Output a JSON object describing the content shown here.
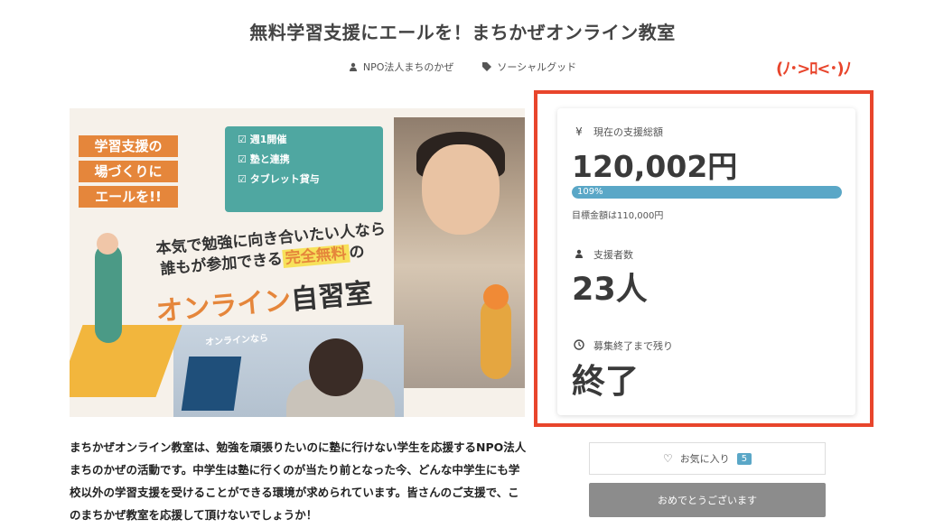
{
  "title": "無料学習支援にエールを！まちかぜオンライン教室",
  "meta": {
    "organizer": "NPO法人まちのかぜ",
    "category": "ソーシャルグッド"
  },
  "hero": {
    "tag1": "学習支援の",
    "tag2": "場づくりに",
    "tag3": "エールを!!",
    "feature1": "☑ 週1開催",
    "feature2": "☑ 塾と連携",
    "feature3": "☑ タブレット貸与",
    "catch1": "本気で勉強に向き合いたい人なら",
    "catch2a": "誰もが参加できる",
    "catch2b": "完全無料",
    "catch2c": "の",
    "big_a": "オンライン",
    "big_b": "自習室",
    "online_label": "オンラインなら"
  },
  "description": "まちかぜオンライン教室は、勉強を頑張りたいのに塾に行けない学生を応援するNPO法人まちのかぜの活動です。中学生は塾に行くのが当たり前となった今、どんな中学生にも学校以外の学習支援を受けることができる環境が求められています。皆さんのご支援で、このまちかぜ教室を応援して頂けないでしょうか！",
  "annotation": "(ﾉ･>ﾛ<･)ﾉ",
  "funding": {
    "total_label": "現在の支援総額",
    "total_value": "120,002円",
    "progress_text": "109%",
    "progress_fraction": 1.0,
    "goal_text": "目標金額は110,000円",
    "supporters_label": "支援者数",
    "supporters_value": "23人",
    "remaining_label": "募集終了まで残り",
    "remaining_value": "終了"
  },
  "favorite": {
    "label": "お気に入り",
    "count": "5"
  },
  "congrats_button": "おめでとうございます",
  "colors": {
    "accent": "#5aa7c7",
    "annotation": "#e8452c",
    "button_gray": "#8c8c8c"
  }
}
